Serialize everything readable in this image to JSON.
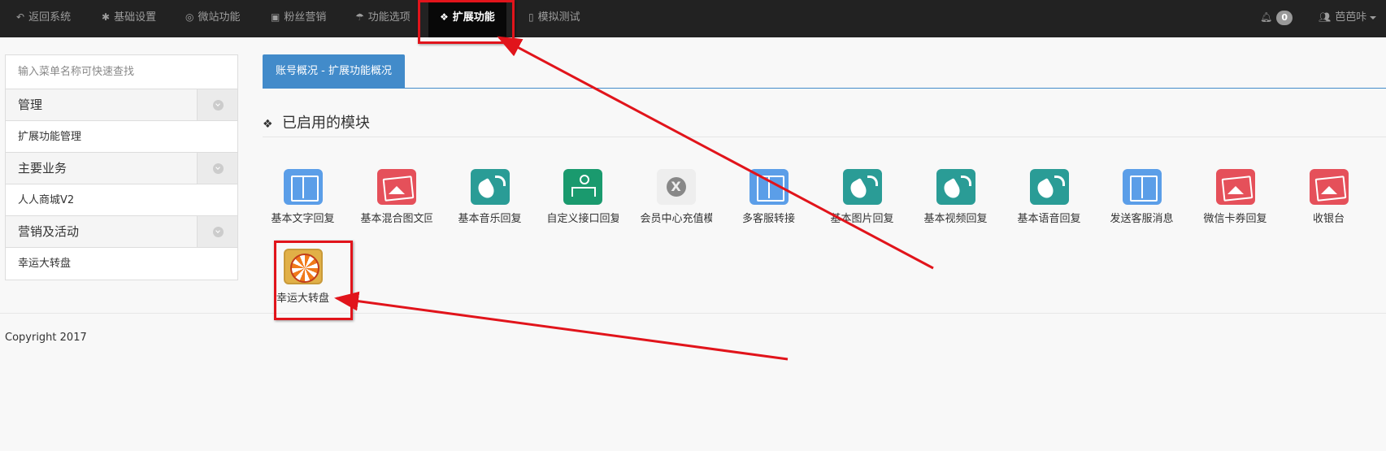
{
  "nav": {
    "items": [
      {
        "icon": "reply-icon",
        "label": "返回系统"
      },
      {
        "icon": "gear-icon",
        "label": "基础设置"
      },
      {
        "icon": "lifebuoy-icon",
        "label": "微站功能"
      },
      {
        "icon": "gift-icon",
        "label": "粉丝营销"
      },
      {
        "icon": "umbrella-icon",
        "label": "功能选项"
      },
      {
        "icon": "cubes-icon",
        "label": "扩展功能",
        "active": true
      },
      {
        "icon": "mobile-icon",
        "label": "模拟测试"
      }
    ],
    "notification_count": "0",
    "user_name": "芭芭咔"
  },
  "sidebar": {
    "search_placeholder": "输入菜单名称可快速查找",
    "groups": [
      {
        "title": "管理",
        "links": [
          "扩展功能管理"
        ]
      },
      {
        "title": "主要业务",
        "links": [
          "人人商城V2"
        ]
      },
      {
        "title": "营销及活动",
        "links": [
          "幸运大转盘"
        ]
      }
    ]
  },
  "main": {
    "tab_label": "账号概况 - 扩展功能概况",
    "section_title": "已启用的模块",
    "modules": [
      {
        "icon": "book-icon",
        "label": "基本文字回复"
      },
      {
        "icon": "picture-icon",
        "label": "基本混合图文回复"
      },
      {
        "icon": "sound-icon",
        "label": "基本音乐回复"
      },
      {
        "icon": "sitemap-icon",
        "label": "自定义接口回复"
      },
      {
        "icon": "cancel-icon",
        "label": "会员中心充值模块"
      },
      {
        "icon": "book-icon",
        "label": "多客服转接"
      },
      {
        "icon": "sound-icon",
        "label": "基本图片回复"
      },
      {
        "icon": "sound-icon",
        "label": "基本视频回复"
      },
      {
        "icon": "sound-icon",
        "label": "基本语音回复"
      },
      {
        "icon": "book-icon",
        "label": "发送客服消息"
      },
      {
        "icon": "picture-icon",
        "label": "微信卡券回复"
      },
      {
        "icon": "picture-icon",
        "label": "收银台"
      },
      {
        "icon": "wheel-icon",
        "label": "幸运大转盘"
      }
    ]
  },
  "footer": {
    "copyright": "Copyright 2017"
  },
  "annotation_color": "#e1141b"
}
